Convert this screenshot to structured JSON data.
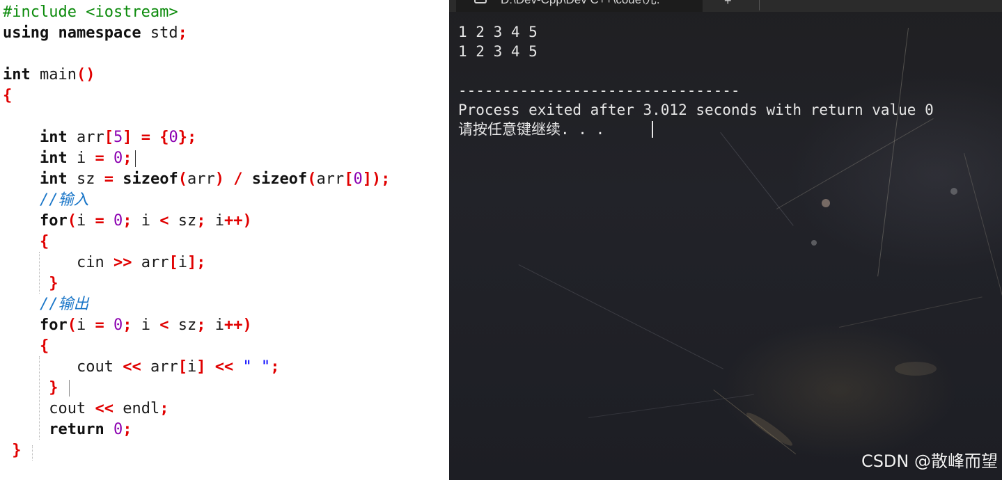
{
  "editor": {
    "lines": [
      {
        "parts": [
          {
            "t": "#include <iostream>",
            "c": "pre"
          }
        ]
      },
      {
        "parts": [
          {
            "t": "using namespace",
            "c": "kw"
          },
          {
            "t": " std",
            "c": ""
          },
          {
            "t": ";",
            "c": "op"
          }
        ]
      },
      {
        "parts": []
      },
      {
        "parts": [
          {
            "t": "int",
            "c": "kw"
          },
          {
            "t": " main",
            "c": ""
          },
          {
            "t": "()",
            "c": "op"
          }
        ]
      },
      {
        "parts": [
          {
            "t": "{",
            "c": "op"
          }
        ]
      },
      {
        "parts": []
      },
      {
        "parts": [
          {
            "t": "    ",
            "c": ""
          },
          {
            "t": "int",
            "c": "kw"
          },
          {
            "t": " arr",
            "c": ""
          },
          {
            "t": "[",
            "c": "op"
          },
          {
            "t": "5",
            "c": "num"
          },
          {
            "t": "]",
            "c": "op"
          },
          {
            "t": " ",
            "c": ""
          },
          {
            "t": "=",
            "c": "op"
          },
          {
            "t": " ",
            "c": ""
          },
          {
            "t": "{",
            "c": "op"
          },
          {
            "t": "0",
            "c": "num"
          },
          {
            "t": "};",
            "c": "op"
          }
        ]
      },
      {
        "parts": [
          {
            "t": "    ",
            "c": ""
          },
          {
            "t": "int",
            "c": "kw"
          },
          {
            "t": " i ",
            "c": ""
          },
          {
            "t": "=",
            "c": "op"
          },
          {
            "t": " ",
            "c": ""
          },
          {
            "t": "0",
            "c": "num"
          },
          {
            "t": ";",
            "c": "op"
          }
        ]
      },
      {
        "parts": [
          {
            "t": "    ",
            "c": ""
          },
          {
            "t": "int",
            "c": "kw"
          },
          {
            "t": " sz ",
            "c": ""
          },
          {
            "t": "=",
            "c": "op"
          },
          {
            "t": " ",
            "c": ""
          },
          {
            "t": "sizeof",
            "c": "kw"
          },
          {
            "t": "(",
            "c": "op"
          },
          {
            "t": "arr",
            "c": ""
          },
          {
            "t": ")",
            "c": "op"
          },
          {
            "t": " ",
            "c": ""
          },
          {
            "t": "/",
            "c": "op"
          },
          {
            "t": " ",
            "c": ""
          },
          {
            "t": "sizeof",
            "c": "kw"
          },
          {
            "t": "(",
            "c": "op"
          },
          {
            "t": "arr",
            "c": ""
          },
          {
            "t": "[",
            "c": "op"
          },
          {
            "t": "0",
            "c": "num"
          },
          {
            "t": "]);",
            "c": "op"
          }
        ]
      },
      {
        "parts": [
          {
            "t": "    ",
            "c": ""
          },
          {
            "t": "//输入",
            "c": "cm"
          }
        ]
      },
      {
        "parts": [
          {
            "t": "    ",
            "c": ""
          },
          {
            "t": "for",
            "c": "kw"
          },
          {
            "t": "(",
            "c": "op"
          },
          {
            "t": "i ",
            "c": ""
          },
          {
            "t": "=",
            "c": "op"
          },
          {
            "t": " ",
            "c": ""
          },
          {
            "t": "0",
            "c": "num"
          },
          {
            "t": ";",
            "c": "op"
          },
          {
            "t": " i ",
            "c": ""
          },
          {
            "t": "<",
            "c": "op"
          },
          {
            "t": " sz",
            "c": ""
          },
          {
            "t": ";",
            "c": "op"
          },
          {
            "t": " i",
            "c": ""
          },
          {
            "t": "++)",
            "c": "op"
          }
        ]
      },
      {
        "parts": [
          {
            "t": "    ",
            "c": ""
          },
          {
            "t": "{",
            "c": "op"
          }
        ]
      },
      {
        "parts": [
          {
            "t": "        ",
            "c": ""
          },
          {
            "t": "cin ",
            "c": ""
          },
          {
            "t": ">>",
            "c": "op"
          },
          {
            "t": " arr",
            "c": ""
          },
          {
            "t": "[",
            "c": "op"
          },
          {
            "t": "i",
            "c": ""
          },
          {
            "t": "];",
            "c": "op"
          }
        ]
      },
      {
        "parts": [
          {
            "t": "     ",
            "c": ""
          },
          {
            "t": "}",
            "c": "op"
          }
        ]
      },
      {
        "parts": [
          {
            "t": "    ",
            "c": ""
          },
          {
            "t": "//输出",
            "c": "cm"
          }
        ]
      },
      {
        "parts": [
          {
            "t": "    ",
            "c": ""
          },
          {
            "t": "for",
            "c": "kw"
          },
          {
            "t": "(",
            "c": "op"
          },
          {
            "t": "i ",
            "c": ""
          },
          {
            "t": "=",
            "c": "op"
          },
          {
            "t": " ",
            "c": ""
          },
          {
            "t": "0",
            "c": "num"
          },
          {
            "t": ";",
            "c": "op"
          },
          {
            "t": " i ",
            "c": ""
          },
          {
            "t": "<",
            "c": "op"
          },
          {
            "t": " sz",
            "c": ""
          },
          {
            "t": ";",
            "c": "op"
          },
          {
            "t": " i",
            "c": ""
          },
          {
            "t": "++)",
            "c": "op"
          }
        ]
      },
      {
        "parts": [
          {
            "t": "    ",
            "c": ""
          },
          {
            "t": "{",
            "c": "op"
          }
        ]
      },
      {
        "parts": [
          {
            "t": "        ",
            "c": ""
          },
          {
            "t": "cout ",
            "c": ""
          },
          {
            "t": "<<",
            "c": "op"
          },
          {
            "t": " arr",
            "c": ""
          },
          {
            "t": "[",
            "c": "op"
          },
          {
            "t": "i",
            "c": ""
          },
          {
            "t": "]",
            "c": "op"
          },
          {
            "t": " ",
            "c": ""
          },
          {
            "t": "<<",
            "c": "op"
          },
          {
            "t": " ",
            "c": ""
          },
          {
            "t": "\" \"",
            "c": "str"
          },
          {
            "t": ";",
            "c": "op"
          }
        ]
      },
      {
        "parts": [
          {
            "t": "     ",
            "c": ""
          },
          {
            "t": "}",
            "c": "op"
          }
        ]
      },
      {
        "parts": [
          {
            "t": "     ",
            "c": ""
          },
          {
            "t": "cout ",
            "c": ""
          },
          {
            "t": "<<",
            "c": "op"
          },
          {
            "t": " endl",
            "c": ""
          },
          {
            "t": ";",
            "c": "op"
          }
        ]
      },
      {
        "parts": [
          {
            "t": "     ",
            "c": ""
          },
          {
            "t": "return",
            "c": "kw"
          },
          {
            "t": " ",
            "c": ""
          },
          {
            "t": "0",
            "c": "num"
          },
          {
            "t": ";",
            "c": "op"
          }
        ]
      },
      {
        "parts": [
          {
            "t": " ",
            "c": ""
          },
          {
            "t": "}",
            "c": "op"
          }
        ]
      }
    ]
  },
  "console": {
    "tab_title": "D:\\Dev-Cpp\\Dev C++\\code\\元...",
    "tab_close": "×",
    "new_tab": "+",
    "output_line_1": "1 2 3 4 5",
    "output_line_2": "1 2 3 4 5",
    "separator": "--------------------------------",
    "process_line": "Process exited after 3.012 seconds with return value 0",
    "prompt_line": "请按任意键继续. . ."
  },
  "watermark": "CSDN @散峰而望",
  "colors": {
    "keyword": "#111111",
    "operator": "#e00000",
    "number": "#8b00b0",
    "string": "#0000ff",
    "comment": "#1a76c8",
    "preprocessor": "#0a8a0a",
    "console_bg": "#1f1f22",
    "console_text": "#e6e6e6"
  }
}
